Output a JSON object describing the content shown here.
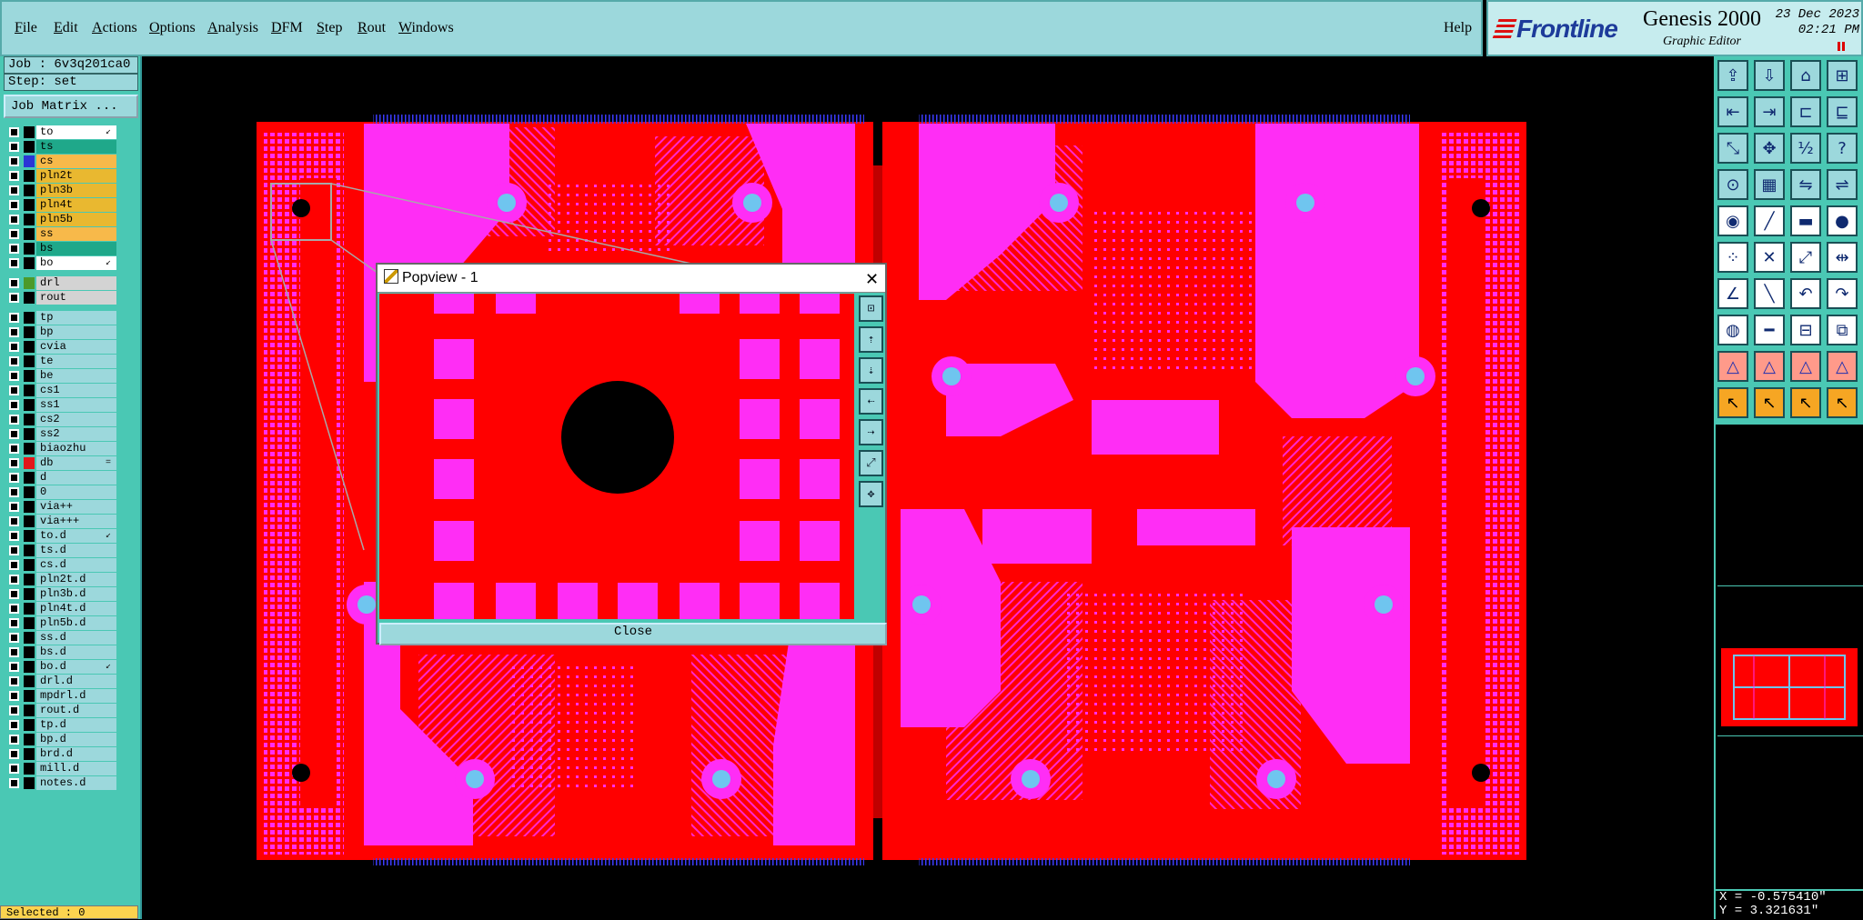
{
  "menubar": {
    "items": [
      {
        "label": "File",
        "u": "F",
        "rest": "ile"
      },
      {
        "label": "Edit",
        "u": "E",
        "rest": "dit"
      },
      {
        "label": "Actions",
        "u": "A",
        "rest": "ctions"
      },
      {
        "label": "Options",
        "u": "O",
        "rest": "ptions"
      },
      {
        "label": "Analysis",
        "u": "A",
        "rest": "nalysis"
      },
      {
        "label": "DFM",
        "u": "D",
        "rest": "FM"
      },
      {
        "label": "Step",
        "u": "S",
        "rest": "tep"
      },
      {
        "label": "Rout",
        "u": "R",
        "rest": "out"
      },
      {
        "label": "Windows",
        "u": "W",
        "rest": "indows"
      }
    ],
    "help": "Help"
  },
  "brand": {
    "logo": "Frontline",
    "title": "Genesis 2000",
    "subtitle": "Graphic Editor",
    "date": "23 Dec 2023",
    "time": "02:21 PM"
  },
  "job": {
    "job_label": "Job : 6v3q201ca0",
    "step_label": "Step: set",
    "matrix_button": "Job Matrix ..."
  },
  "layers": [
    {
      "name": "to",
      "bg": "#ffffff",
      "sw": "#000000",
      "mk": "↙"
    },
    {
      "name": "ts",
      "bg": "#1fa88a",
      "sw": "#000000",
      "mk": ""
    },
    {
      "name": "cs",
      "bg": "#f7b94a",
      "sw": "#2b35d6",
      "mk": ""
    },
    {
      "name": "pln2t",
      "bg": "#e9b830",
      "sw": "#000000",
      "mk": ""
    },
    {
      "name": "pln3b",
      "bg": "#e9b830",
      "sw": "#000000",
      "mk": ""
    },
    {
      "name": "pln4t",
      "bg": "#e9b830",
      "sw": "#000000",
      "mk": ""
    },
    {
      "name": "pln5b",
      "bg": "#e9b830",
      "sw": "#000000",
      "mk": ""
    },
    {
      "name": "ss",
      "bg": "#f7b94a",
      "sw": "#000000",
      "mk": ""
    },
    {
      "name": "bs",
      "bg": "#1fa88a",
      "sw": "#000000",
      "mk": ""
    },
    {
      "name": "bo",
      "bg": "#ffffff",
      "sw": "#000000",
      "mk": "↙"
    },
    {
      "name": "drl",
      "bg": "#d3d3d3",
      "sw": "#4c9a2a",
      "mk": ""
    },
    {
      "name": "rout",
      "bg": "#d3d3d3",
      "sw": "#000000",
      "mk": ""
    },
    {
      "name": "tp",
      "bg": "#9cd8dc",
      "sw": "#000000",
      "mk": ""
    },
    {
      "name": "bp",
      "bg": "#9cd8dc",
      "sw": "#000000",
      "mk": ""
    },
    {
      "name": "cvia",
      "bg": "#9cd8dc",
      "sw": "#000000",
      "mk": ""
    },
    {
      "name": "te",
      "bg": "#9cd8dc",
      "sw": "#000000",
      "mk": ""
    },
    {
      "name": "be",
      "bg": "#9cd8dc",
      "sw": "#000000",
      "mk": ""
    },
    {
      "name": "cs1",
      "bg": "#9cd8dc",
      "sw": "#000000",
      "mk": ""
    },
    {
      "name": "ss1",
      "bg": "#9cd8dc",
      "sw": "#000000",
      "mk": ""
    },
    {
      "name": "cs2",
      "bg": "#9cd8dc",
      "sw": "#000000",
      "mk": ""
    },
    {
      "name": "ss2",
      "bg": "#9cd8dc",
      "sw": "#000000",
      "mk": ""
    },
    {
      "name": "biaozhu",
      "bg": "#9cd8dc",
      "sw": "#000000",
      "mk": ""
    },
    {
      "name": "db",
      "bg": "#9cd8dc",
      "sw": "#e3171a",
      "mk": "="
    },
    {
      "name": "d",
      "bg": "#9cd8dc",
      "sw": "#000000",
      "mk": ""
    },
    {
      "name": "0",
      "bg": "#9cd8dc",
      "sw": "#000000",
      "mk": ""
    },
    {
      "name": "via++",
      "bg": "#9cd8dc",
      "sw": "#000000",
      "mk": ""
    },
    {
      "name": "via+++",
      "bg": "#9cd8dc",
      "sw": "#000000",
      "mk": ""
    },
    {
      "name": "to.d",
      "bg": "#9cd8dc",
      "sw": "#000000",
      "mk": "↙"
    },
    {
      "name": "ts.d",
      "bg": "#9cd8dc",
      "sw": "#000000",
      "mk": ""
    },
    {
      "name": "cs.d",
      "bg": "#9cd8dc",
      "sw": "#000000",
      "mk": ""
    },
    {
      "name": "pln2t.d",
      "bg": "#9cd8dc",
      "sw": "#000000",
      "mk": ""
    },
    {
      "name": "pln3b.d",
      "bg": "#9cd8dc",
      "sw": "#000000",
      "mk": ""
    },
    {
      "name": "pln4t.d",
      "bg": "#9cd8dc",
      "sw": "#000000",
      "mk": ""
    },
    {
      "name": "pln5b.d",
      "bg": "#9cd8dc",
      "sw": "#000000",
      "mk": ""
    },
    {
      "name": "ss.d",
      "bg": "#9cd8dc",
      "sw": "#000000",
      "mk": ""
    },
    {
      "name": "bs.d",
      "bg": "#9cd8dc",
      "sw": "#000000",
      "mk": ""
    },
    {
      "name": "bo.d",
      "bg": "#9cd8dc",
      "sw": "#000000",
      "mk": "↙"
    },
    {
      "name": "drl.d",
      "bg": "#9cd8dc",
      "sw": "#000000",
      "mk": ""
    },
    {
      "name": "mpdrl.d",
      "bg": "#9cd8dc",
      "sw": "#000000",
      "mk": ""
    },
    {
      "name": "rout.d",
      "bg": "#9cd8dc",
      "sw": "#000000",
      "mk": ""
    },
    {
      "name": "tp.d",
      "bg": "#9cd8dc",
      "sw": "#000000",
      "mk": ""
    },
    {
      "name": "bp.d",
      "bg": "#9cd8dc",
      "sw": "#000000",
      "mk": ""
    },
    {
      "name": "brd.d",
      "bg": "#9cd8dc",
      "sw": "#000000",
      "mk": ""
    },
    {
      "name": "mill.d",
      "bg": "#9cd8dc",
      "sw": "#000000",
      "mk": ""
    },
    {
      "name": "notes.d",
      "bg": "#9cd8dc",
      "sw": "#000000",
      "mk": ""
    }
  ],
  "status": {
    "selected": "Selected : 0",
    "x": "X = -0.575410\"",
    "y": "Y = 3.321631\""
  },
  "popview": {
    "title": "Popview - 1",
    "close_button": "Close"
  },
  "toolbox": {
    "icons": [
      "zoom-home-icon",
      "zoom-in-icon",
      "zoom-out-icon",
      "zoom-fit-icon",
      "pan-left-icon",
      "pan-right-icon",
      "zoom-area-icon",
      "redraw-icon",
      "fill-screen-icon",
      "center-icon",
      "scale-12-icon",
      "help-icon",
      "measure-icon",
      "grid-icon",
      "snap-icon",
      "layer-snap-icon",
      "pad-icon",
      "line-icon",
      "dash-icon",
      "circle-icon",
      "node-icon",
      "cross-node-icon",
      "joint-icon",
      "slot-icon",
      "angle-icon",
      "line-diag-icon",
      "arc-icon",
      "arc-flip-icon",
      "pad-add-icon",
      "line-add-icon",
      "box-add-icon",
      "group-icon",
      "poly-1-icon",
      "poly-2-icon",
      "poly-3-icon",
      "poly-4-icon",
      "select-icon",
      "select-add-icon",
      "select-move-icon",
      "select-multi-icon"
    ]
  },
  "colors": {
    "board": "#ff0000",
    "copper": "#ff2df5",
    "drill": "#6fc5ef",
    "ui_panel": "#4ac8b4",
    "ui_button": "#9cd8dc"
  }
}
